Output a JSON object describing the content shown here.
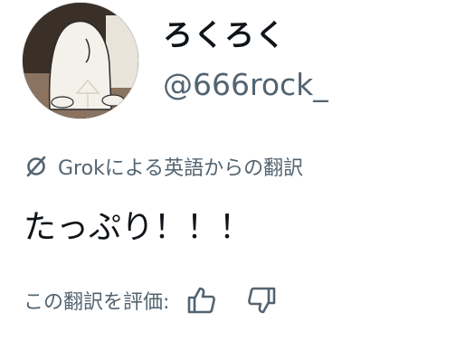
{
  "profile": {
    "display_name": "ろくろく",
    "handle": "@666rock_",
    "avatar_icon": "avatar-image"
  },
  "translation": {
    "icon": "grok-icon",
    "label": "Grokによる英語からの翻訳"
  },
  "post": {
    "text": "たっぷり！！！"
  },
  "rating": {
    "label": "この翻訳を評価:",
    "thumbs_up_icon": "thumbs-up-icon",
    "thumbs_down_icon": "thumbs-down-icon"
  },
  "colors": {
    "text_primary": "#0f1419",
    "text_secondary": "#536471",
    "background": "#ffffff"
  }
}
